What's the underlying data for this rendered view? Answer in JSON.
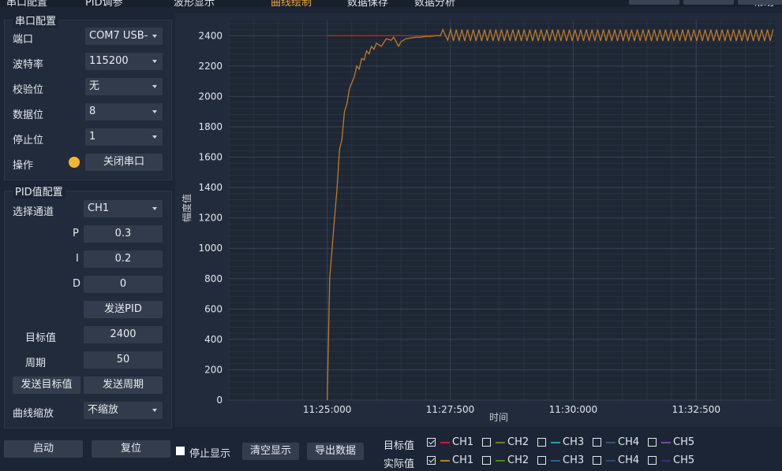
{
  "top_menu": {
    "items": [
      "串口配置",
      "PID调参",
      "波形显示",
      "曲线绘制",
      "数据保存",
      "数据分析",
      "帮助"
    ],
    "active_index": 3,
    "active_color": "#f0a73a"
  },
  "serial": {
    "title": "串口配置",
    "port_label": "端口",
    "port_value": "COM7 USB-",
    "baud_label": "波特率",
    "baud_value": "115200",
    "parity_label": "校验位",
    "parity_value": "无",
    "databits_label": "数据位",
    "databits_value": "8",
    "stopbits_label": "停止位",
    "stopbits_value": "1",
    "op_label": "操作",
    "status_color": "#f5b731",
    "close_button": "关闭串口"
  },
  "pid": {
    "title": "PID值配置",
    "channel_label": "选择通道",
    "channel_value": "CH1",
    "p_label": "P",
    "p_value": "0.3",
    "i_label": "I",
    "i_value": "0.2",
    "d_label": "D",
    "d_value": "0",
    "send_pid_button": "发送PID",
    "target_label": "目标值",
    "target_value": "2400",
    "period_label": "周期",
    "period_value": "50",
    "send_target_button": "发送目标值",
    "send_period_button": "发送周期",
    "zoom_label": "曲线缩放",
    "zoom_value": "不缩放"
  },
  "bottom": {
    "start_button": "启动",
    "reset_button": "复位",
    "stop_display_label": "停止显示",
    "clear_button": "清空显示",
    "export_button": "导出数据",
    "target_row_label": "目标值",
    "actual_row_label": "实际值",
    "channels": [
      "CH1",
      "CH2",
      "CH3",
      "CH4",
      "CH5"
    ],
    "target_colors": [
      "#c0202a",
      "#7a7a22",
      "#1aa3b8",
      "#2d5a70",
      "#7a4aa8"
    ],
    "actual_colors": [
      "#c07a28",
      "#3f8a2a",
      "#1a6a9a",
      "#2f4a78",
      "#3a2a7a"
    ],
    "target_checked": [
      true,
      false,
      false,
      false,
      false
    ],
    "actual_checked": [
      true,
      false,
      false,
      false,
      false
    ]
  },
  "chart_data": {
    "type": "line",
    "title": "",
    "xlabel": "时间",
    "ylabel": "幅度值",
    "ylim": [
      0,
      2500
    ],
    "yticks": [
      0,
      200,
      400,
      600,
      800,
      1000,
      1200,
      1400,
      1600,
      1800,
      2000,
      2200,
      2400
    ],
    "xticks": [
      "11:25:000",
      "11:27:500",
      "11:30:000",
      "11:32:500"
    ],
    "x_range_s": [
      -2.0,
      9.1
    ],
    "grid": true,
    "series": [
      {
        "role": "target",
        "color": "#c0202a",
        "x": [
          0.0,
          2.3
        ],
        "y": [
          2400,
          2400
        ]
      },
      {
        "role": "actual",
        "color": "#c07a28",
        "x": [
          0.0,
          0.05,
          0.1,
          0.15,
          0.2,
          0.25,
          0.3,
          0.35,
          0.4,
          0.45,
          0.5,
          0.55,
          0.6,
          0.65,
          0.7,
          0.75,
          0.8,
          0.85,
          0.9,
          0.95,
          1.0,
          1.1,
          1.2,
          1.3,
          1.35,
          1.4,
          1.45,
          1.5,
          1.55,
          1.6,
          1.7,
          1.8,
          1.9,
          2.0,
          2.1,
          2.2,
          2.3,
          2.35,
          2.45
        ],
        "y": [
          0,
          800,
          1000,
          1200,
          1400,
          1650,
          1720,
          1900,
          1950,
          2050,
          2090,
          2130,
          2200,
          2180,
          2250,
          2240,
          2300,
          2280,
          2330,
          2310,
          2350,
          2330,
          2380,
          2370,
          2390,
          2360,
          2330,
          2360,
          2370,
          2380,
          2385,
          2390,
          2390,
          2395,
          2395,
          2400,
          2400,
          2440,
          2370
        ],
        "oscillation": {
          "from_s": 2.45,
          "to_s": 9.1,
          "period_s": 0.115,
          "high": 2440,
          "low": 2365
        }
      }
    ]
  }
}
